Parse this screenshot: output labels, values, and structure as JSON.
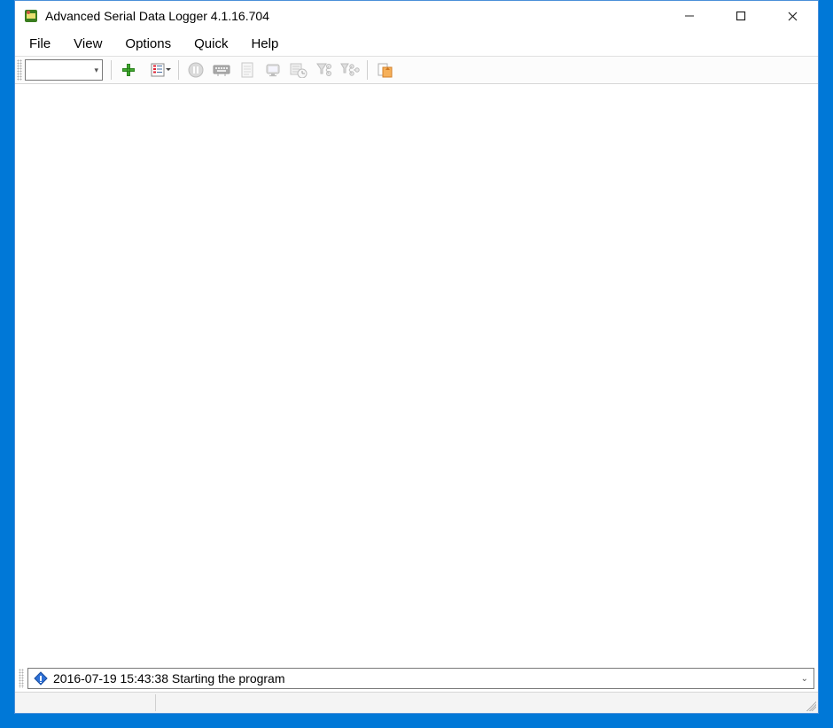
{
  "window": {
    "title": "Advanced Serial Data Logger 4.1.16.704"
  },
  "menubar": [
    "File",
    "View",
    "Options",
    "Quick",
    "Help"
  ],
  "toolbar": {
    "combo_value": "",
    "icons": {
      "add": "add-icon",
      "list": "list-icon",
      "pause": "pause-icon",
      "keyboard": "keyboard-icon",
      "document": "document-icon",
      "monitor": "monitor-icon",
      "clock": "clock-settings-icon",
      "filter1": "filter-nodes-icon",
      "filter2": "filter-chain-icon",
      "export": "export-icon"
    }
  },
  "status_log": {
    "text": "2016-07-19 15:43:38 Starting the program"
  }
}
